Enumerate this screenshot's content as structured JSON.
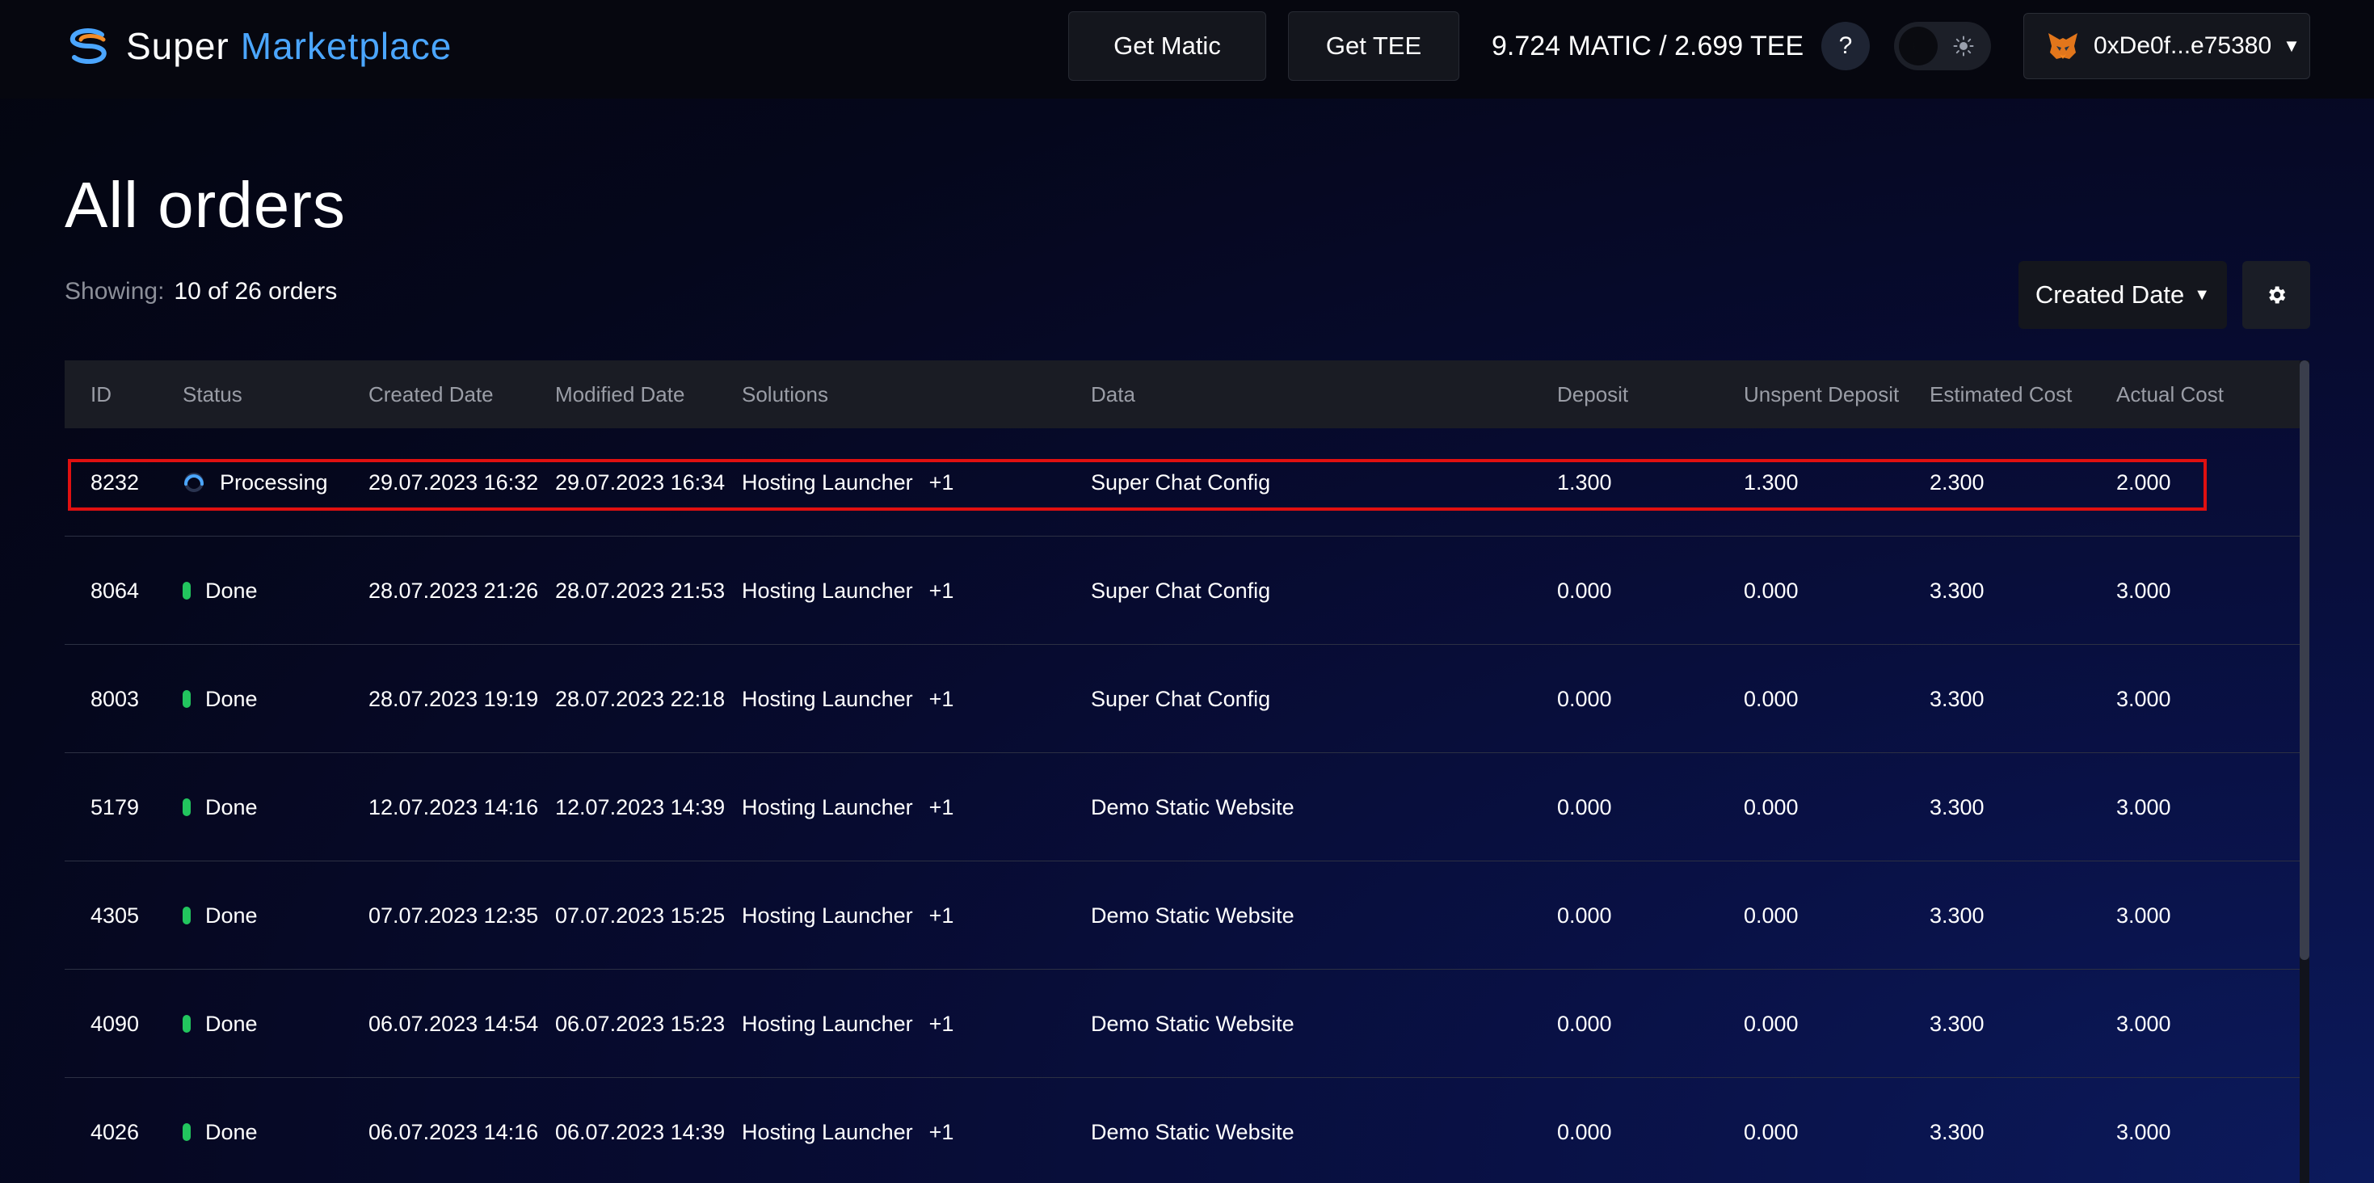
{
  "brand": {
    "part1": "Super",
    "part2": "Marketplace"
  },
  "header": {
    "get_matic": "Get Matic",
    "get_tee": "Get TEE",
    "balance": "9.724 MATIC / 2.699 TEE",
    "help": "?",
    "wallet": "0xDe0f...e75380"
  },
  "page": {
    "title": "All orders",
    "showing_label": "Showing:",
    "showing_value": "10 of 26 orders",
    "sort_label": "Created Date"
  },
  "columns": [
    "ID",
    "Status",
    "Created Date",
    "Modified Date",
    "Solutions",
    "Data",
    "Deposit",
    "Unspent Deposit",
    "Estimated Cost",
    "Actual Cost"
  ],
  "orders": [
    {
      "id": "8232",
      "status": "Processing",
      "created": "29.07.2023 16:32",
      "modified": "29.07.2023 16:34",
      "solution": "Hosting Launcher",
      "extra": "+1",
      "data": "Super Chat Config",
      "deposit": "1.300",
      "unspent": "1.300",
      "estimated": "2.300",
      "actual": "2.000"
    },
    {
      "id": "8064",
      "status": "Done",
      "created": "28.07.2023 21:26",
      "modified": "28.07.2023 21:53",
      "solution": "Hosting Launcher",
      "extra": "+1",
      "data": "Super Chat Config",
      "deposit": "0.000",
      "unspent": "0.000",
      "estimated": "3.300",
      "actual": "3.000"
    },
    {
      "id": "8003",
      "status": "Done",
      "created": "28.07.2023 19:19",
      "modified": "28.07.2023 22:18",
      "solution": "Hosting Launcher",
      "extra": "+1",
      "data": "Super Chat Config",
      "deposit": "0.000",
      "unspent": "0.000",
      "estimated": "3.300",
      "actual": "3.000"
    },
    {
      "id": "5179",
      "status": "Done",
      "created": "12.07.2023 14:16",
      "modified": "12.07.2023 14:39",
      "solution": "Hosting Launcher",
      "extra": "+1",
      "data": "Demo Static Website",
      "deposit": "0.000",
      "unspent": "0.000",
      "estimated": "3.300",
      "actual": "3.000"
    },
    {
      "id": "4305",
      "status": "Done",
      "created": "07.07.2023 12:35",
      "modified": "07.07.2023 15:25",
      "solution": "Hosting Launcher",
      "extra": "+1",
      "data": "Demo Static Website",
      "deposit": "0.000",
      "unspent": "0.000",
      "estimated": "3.300",
      "actual": "3.000"
    },
    {
      "id": "4090",
      "status": "Done",
      "created": "06.07.2023 14:54",
      "modified": "06.07.2023 15:23",
      "solution": "Hosting Launcher",
      "extra": "+1",
      "data": "Demo Static Website",
      "deposit": "0.000",
      "unspent": "0.000",
      "estimated": "3.300",
      "actual": "3.000"
    },
    {
      "id": "4026",
      "status": "Done",
      "created": "06.07.2023 14:16",
      "modified": "06.07.2023 14:39",
      "solution": "Hosting Launcher",
      "extra": "+1",
      "data": "Demo Static Website",
      "deposit": "0.000",
      "unspent": "0.000",
      "estimated": "3.300",
      "actual": "3.000"
    }
  ],
  "icons": {
    "logo": "super-logo-icon",
    "theme_dark": "moon-icon",
    "theme_light": "sun-icon",
    "wallet": "metamask-fox-icon",
    "settings": "gear-icon",
    "processing": "spinner-icon"
  },
  "colors": {
    "accent_blue": "#4ba6ff",
    "done_green": "#22c55e",
    "highlight_red": "#e01010"
  }
}
